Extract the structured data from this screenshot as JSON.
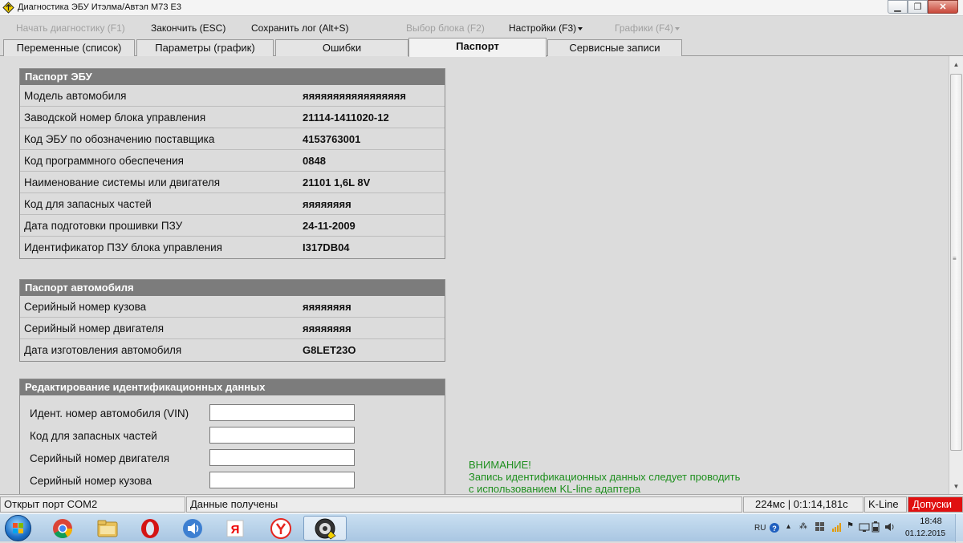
{
  "window": {
    "title": "Диагностика ЭБУ Итэлма/Автэл М73 Е3"
  },
  "menu": {
    "start_diag": "Начать диагностику (F1)",
    "finish": "Закончить (ESC)",
    "save_log": "Сохранить лог (Alt+S)",
    "select_block": "Выбор блока (F2)",
    "settings": "Настройки (F3)",
    "charts": "Графики (F4)"
  },
  "tabs": [
    {
      "label": "Переменные (список)",
      "active": false
    },
    {
      "label": "Параметры (график)",
      "active": false
    },
    {
      "label": "Ошибки",
      "active": false
    },
    {
      "label": "Паспорт",
      "active": true
    },
    {
      "label": "Сервисные записи",
      "active": false
    }
  ],
  "ecu_passport": {
    "header": "Паспорт ЭБУ",
    "rows": [
      {
        "label": "Модель автомобиля",
        "value": "яяяяяяяяяяяяяяяяя"
      },
      {
        "label": "Заводской номер блока управления",
        "value": "21114-1411020-12"
      },
      {
        "label": "Код ЭБУ по обозначению поставщика",
        "value": "4153763001"
      },
      {
        "label": "Код программного обеспечения",
        "value": "0848"
      },
      {
        "label": "Наименование системы или двигателя",
        "value": "21101 1,6L 8V"
      },
      {
        "label": "Код для запасных частей",
        "value": "яяяяяяяя"
      },
      {
        "label": "Дата подготовки прошивки ПЗУ",
        "value": "24-11-2009"
      },
      {
        "label": "Идентификатор ПЗУ блока управления",
        "value": "I317DB04"
      }
    ]
  },
  "car_passport": {
    "header": "Паспорт автомобиля",
    "rows": [
      {
        "label": "Серийный номер кузова",
        "value": "яяяяяяяя"
      },
      {
        "label": "Серийный номер двигателя",
        "value": "яяяяяяяя"
      },
      {
        "label": "Дата изготовления автомобиля",
        "value": "G8LET23O"
      }
    ]
  },
  "edit_id": {
    "header": "Редактирование идентификационных данных",
    "fields": [
      {
        "label": "Идент. номер автомобиля (VIN)",
        "value": ""
      },
      {
        "label": "Код для запасных частей",
        "value": ""
      },
      {
        "label": "Серийный номер двигателя",
        "value": ""
      },
      {
        "label": "Серийный номер кузова",
        "value": ""
      }
    ]
  },
  "warning": {
    "title": "ВНИМАНИЕ!",
    "line1": "Запись идентификационных данных следует проводить",
    "line2": "с использованием KL-line адаптера"
  },
  "status": {
    "port": "Открыт порт COM2",
    "data": "Данные получены",
    "timing": "224мс | 0:1:14,181с",
    "line": "K-Line",
    "mode": "Допуски"
  },
  "taskbar": {
    "items": [
      "chrome-icon",
      "explorer-icon",
      "opera-icon",
      "media-icon",
      "yandex-icon",
      "yandex-browser-icon",
      "diagnostics-app-icon"
    ],
    "lang": "RU",
    "time": "18:48",
    "date": "01.12.2015"
  },
  "colors": {
    "panel_header": "#7c7c7c",
    "warning_text": "#1e8f1e",
    "mode_bg": "#e01010"
  }
}
